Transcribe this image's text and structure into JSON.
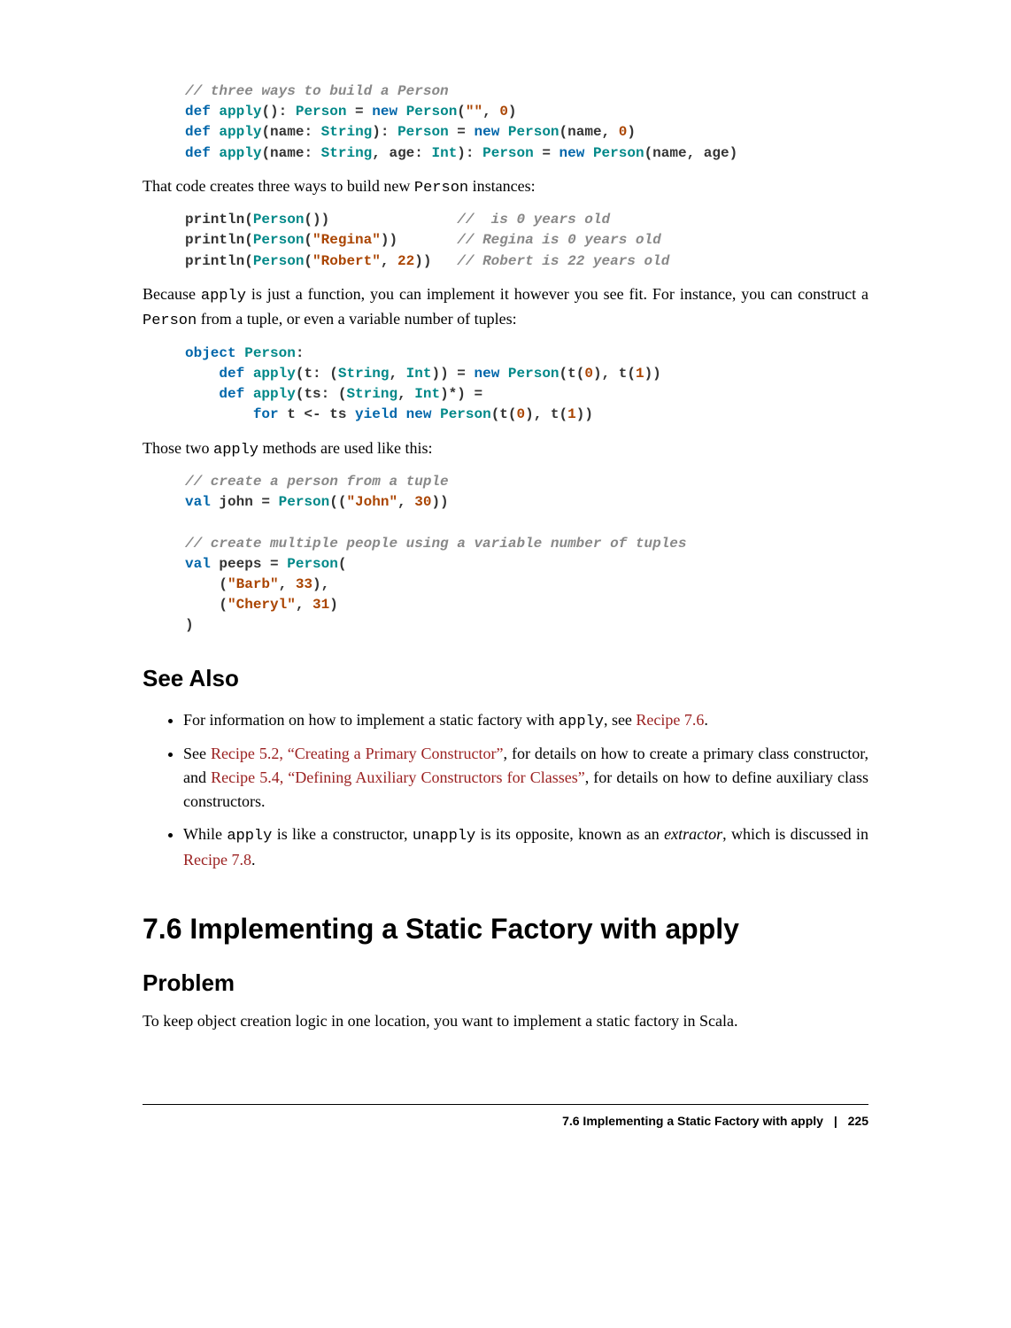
{
  "code1": {
    "c1": "// three ways to build a Person",
    "l2a": "def",
    "l2b": "apply",
    "l2c": "Person",
    "l2d": "new",
    "l2e": "Person",
    "l2f": "\"\"",
    "l2g": "0",
    "l3a": "def",
    "l3b": "apply",
    "l3c": "String",
    "l3d": "Person",
    "l3e": "new",
    "l3f": "Person",
    "l3g": "0",
    "l4a": "def",
    "l4b": "apply",
    "l4c": "String",
    "l4d": "Int",
    "l4e": "Person",
    "l4f": "new",
    "l4g": "Person"
  },
  "p1a": "That code creates three ways to build new ",
  "p1b": "Person",
  "p1c": " instances:",
  "code2": {
    "l1a": "Person",
    "l1c": "//  is 0 years old",
    "l2a": "Person",
    "l2b": "\"Regina\"",
    "l2c": "// Regina is 0 years old",
    "l3a": "Person",
    "l3b": "\"Robert\"",
    "l3n": "22",
    "l3c": "// Robert is 22 years old"
  },
  "p2a": "Because ",
  "p2b": "apply",
  "p2c": " is just a function, you can implement it however you see fit. For instance, you can construct a ",
  "p2d": "Person",
  "p2e": " from a tuple, or even a variable number of tuples:",
  "code3": {
    "l1a": "object",
    "l1b": "Person",
    "l2a": "def",
    "l2b": "apply",
    "l2c": "String",
    "l2d": "Int",
    "l2e": "new",
    "l2f": "Person",
    "l2g": "0",
    "l2h": "1",
    "l3a": "def",
    "l3b": "apply",
    "l3c": "String",
    "l3d": "Int",
    "l4a": "for",
    "l4b": "yield",
    "l4c": "new",
    "l4d": "Person",
    "l4e": "0",
    "l4f": "1"
  },
  "p3a": "Those two ",
  "p3b": "apply",
  "p3c": " methods are used like this:",
  "code4": {
    "c1": "// create a person from a tuple",
    "l2a": "val",
    "l2b": "Person",
    "l2c": "\"John\"",
    "l2d": "30",
    "c2": "// create multiple people using a variable number of tuples",
    "l4a": "val",
    "l4b": "Person",
    "l5a": "\"Barb\"",
    "l5b": "33",
    "l6a": "\"Cheryl\"",
    "l6b": "31"
  },
  "seealso": "See Also",
  "li1a": "For information on how to implement a static factory with ",
  "li1b": "apply",
  "li1c": ", see ",
  "li1d": "Recipe 7.6",
  "li1e": ".",
  "li2a": "See ",
  "li2b": "Recipe 5.2, “Creating a Primary Constructor”",
  "li2c": ", for details on how to create a primary class constructor, and ",
  "li2d": "Recipe 5.4, “Defining Auxiliary Constructors for Classes”",
  "li2e": ", for details on how to define auxiliary class constructors.",
  "li3a": "While ",
  "li3b": "apply",
  "li3c": " is like a constructor, ",
  "li3d": "unapply",
  "li3e": " is its opposite, known as an ",
  "li3f": "extractor",
  "li3g": ", which is discussed in ",
  "li3h": "Recipe 7.8",
  "li3i": ".",
  "h1": "7.6 Implementing a Static Factory with apply",
  "problem": "Problem",
  "p4": "To keep object creation logic in one location, you want to implement a static factory in Scala.",
  "footer": {
    "title": "7.6 Implementing a Static Factory with apply",
    "sep": "|",
    "page": "225"
  }
}
